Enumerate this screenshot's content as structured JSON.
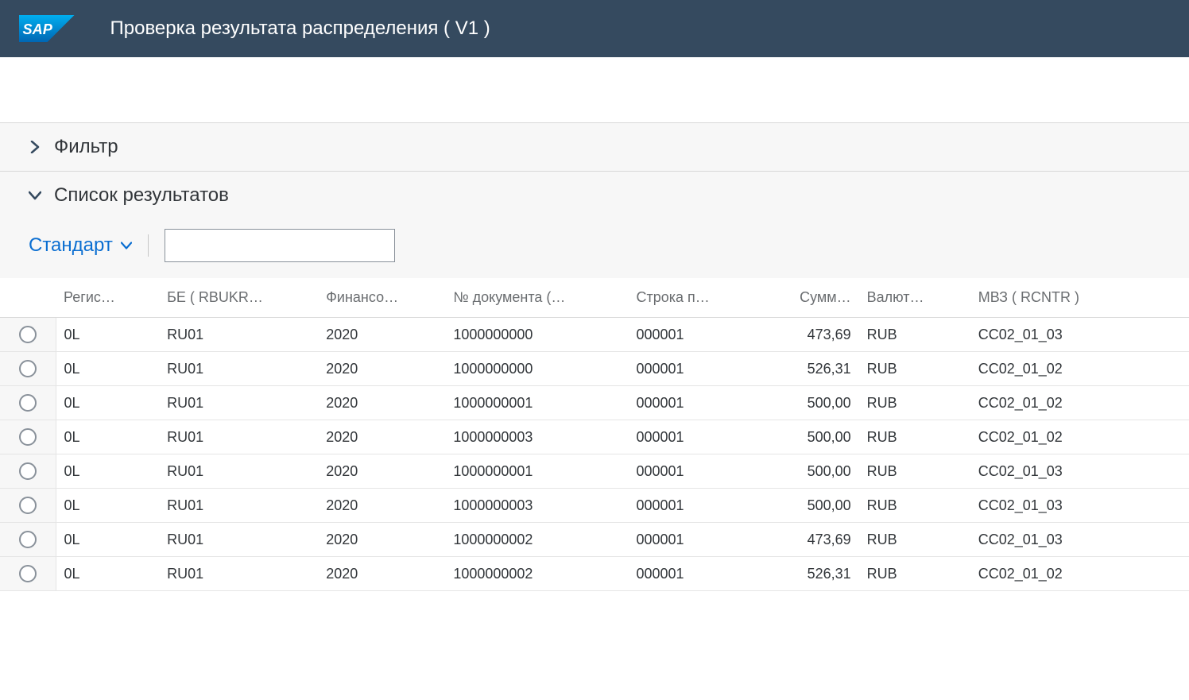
{
  "header": {
    "title": "Проверка результата распределения ( V1 )"
  },
  "filter": {
    "title": "Фильтр",
    "expanded": false
  },
  "results": {
    "title": "Список результатов",
    "expanded": true,
    "view_label": "Стандарт",
    "search_value": "",
    "columns": [
      "Регис…",
      "БЕ ( RBUKR…",
      "Финансо…",
      "№ документа (…",
      "Строка п…",
      "Сумм…",
      "Валют…",
      "МВЗ ( RCNTR )"
    ],
    "rows": [
      {
        "regis": "0L",
        "be": "RU01",
        "fin": "2020",
        "doc": "1000000000",
        "line": "000001",
        "sum": "473,69",
        "cur": "RUB",
        "mvz": "CC02_01_03"
      },
      {
        "regis": "0L",
        "be": "RU01",
        "fin": "2020",
        "doc": "1000000000",
        "line": "000001",
        "sum": "526,31",
        "cur": "RUB",
        "mvz": "CC02_01_02"
      },
      {
        "regis": "0L",
        "be": "RU01",
        "fin": "2020",
        "doc": "1000000001",
        "line": "000001",
        "sum": "500,00",
        "cur": "RUB",
        "mvz": "CC02_01_02"
      },
      {
        "regis": "0L",
        "be": "RU01",
        "fin": "2020",
        "doc": "1000000003",
        "line": "000001",
        "sum": "500,00",
        "cur": "RUB",
        "mvz": "CC02_01_02"
      },
      {
        "regis": "0L",
        "be": "RU01",
        "fin": "2020",
        "doc": "1000000001",
        "line": "000001",
        "sum": "500,00",
        "cur": "RUB",
        "mvz": "CC02_01_03"
      },
      {
        "regis": "0L",
        "be": "RU01",
        "fin": "2020",
        "doc": "1000000003",
        "line": "000001",
        "sum": "500,00",
        "cur": "RUB",
        "mvz": "CC02_01_03"
      },
      {
        "regis": "0L",
        "be": "RU01",
        "fin": "2020",
        "doc": "1000000002",
        "line": "000001",
        "sum": "473,69",
        "cur": "RUB",
        "mvz": "CC02_01_03"
      },
      {
        "regis": "0L",
        "be": "RU01",
        "fin": "2020",
        "doc": "1000000002",
        "line": "000001",
        "sum": "526,31",
        "cur": "RUB",
        "mvz": "CC02_01_02"
      }
    ]
  }
}
